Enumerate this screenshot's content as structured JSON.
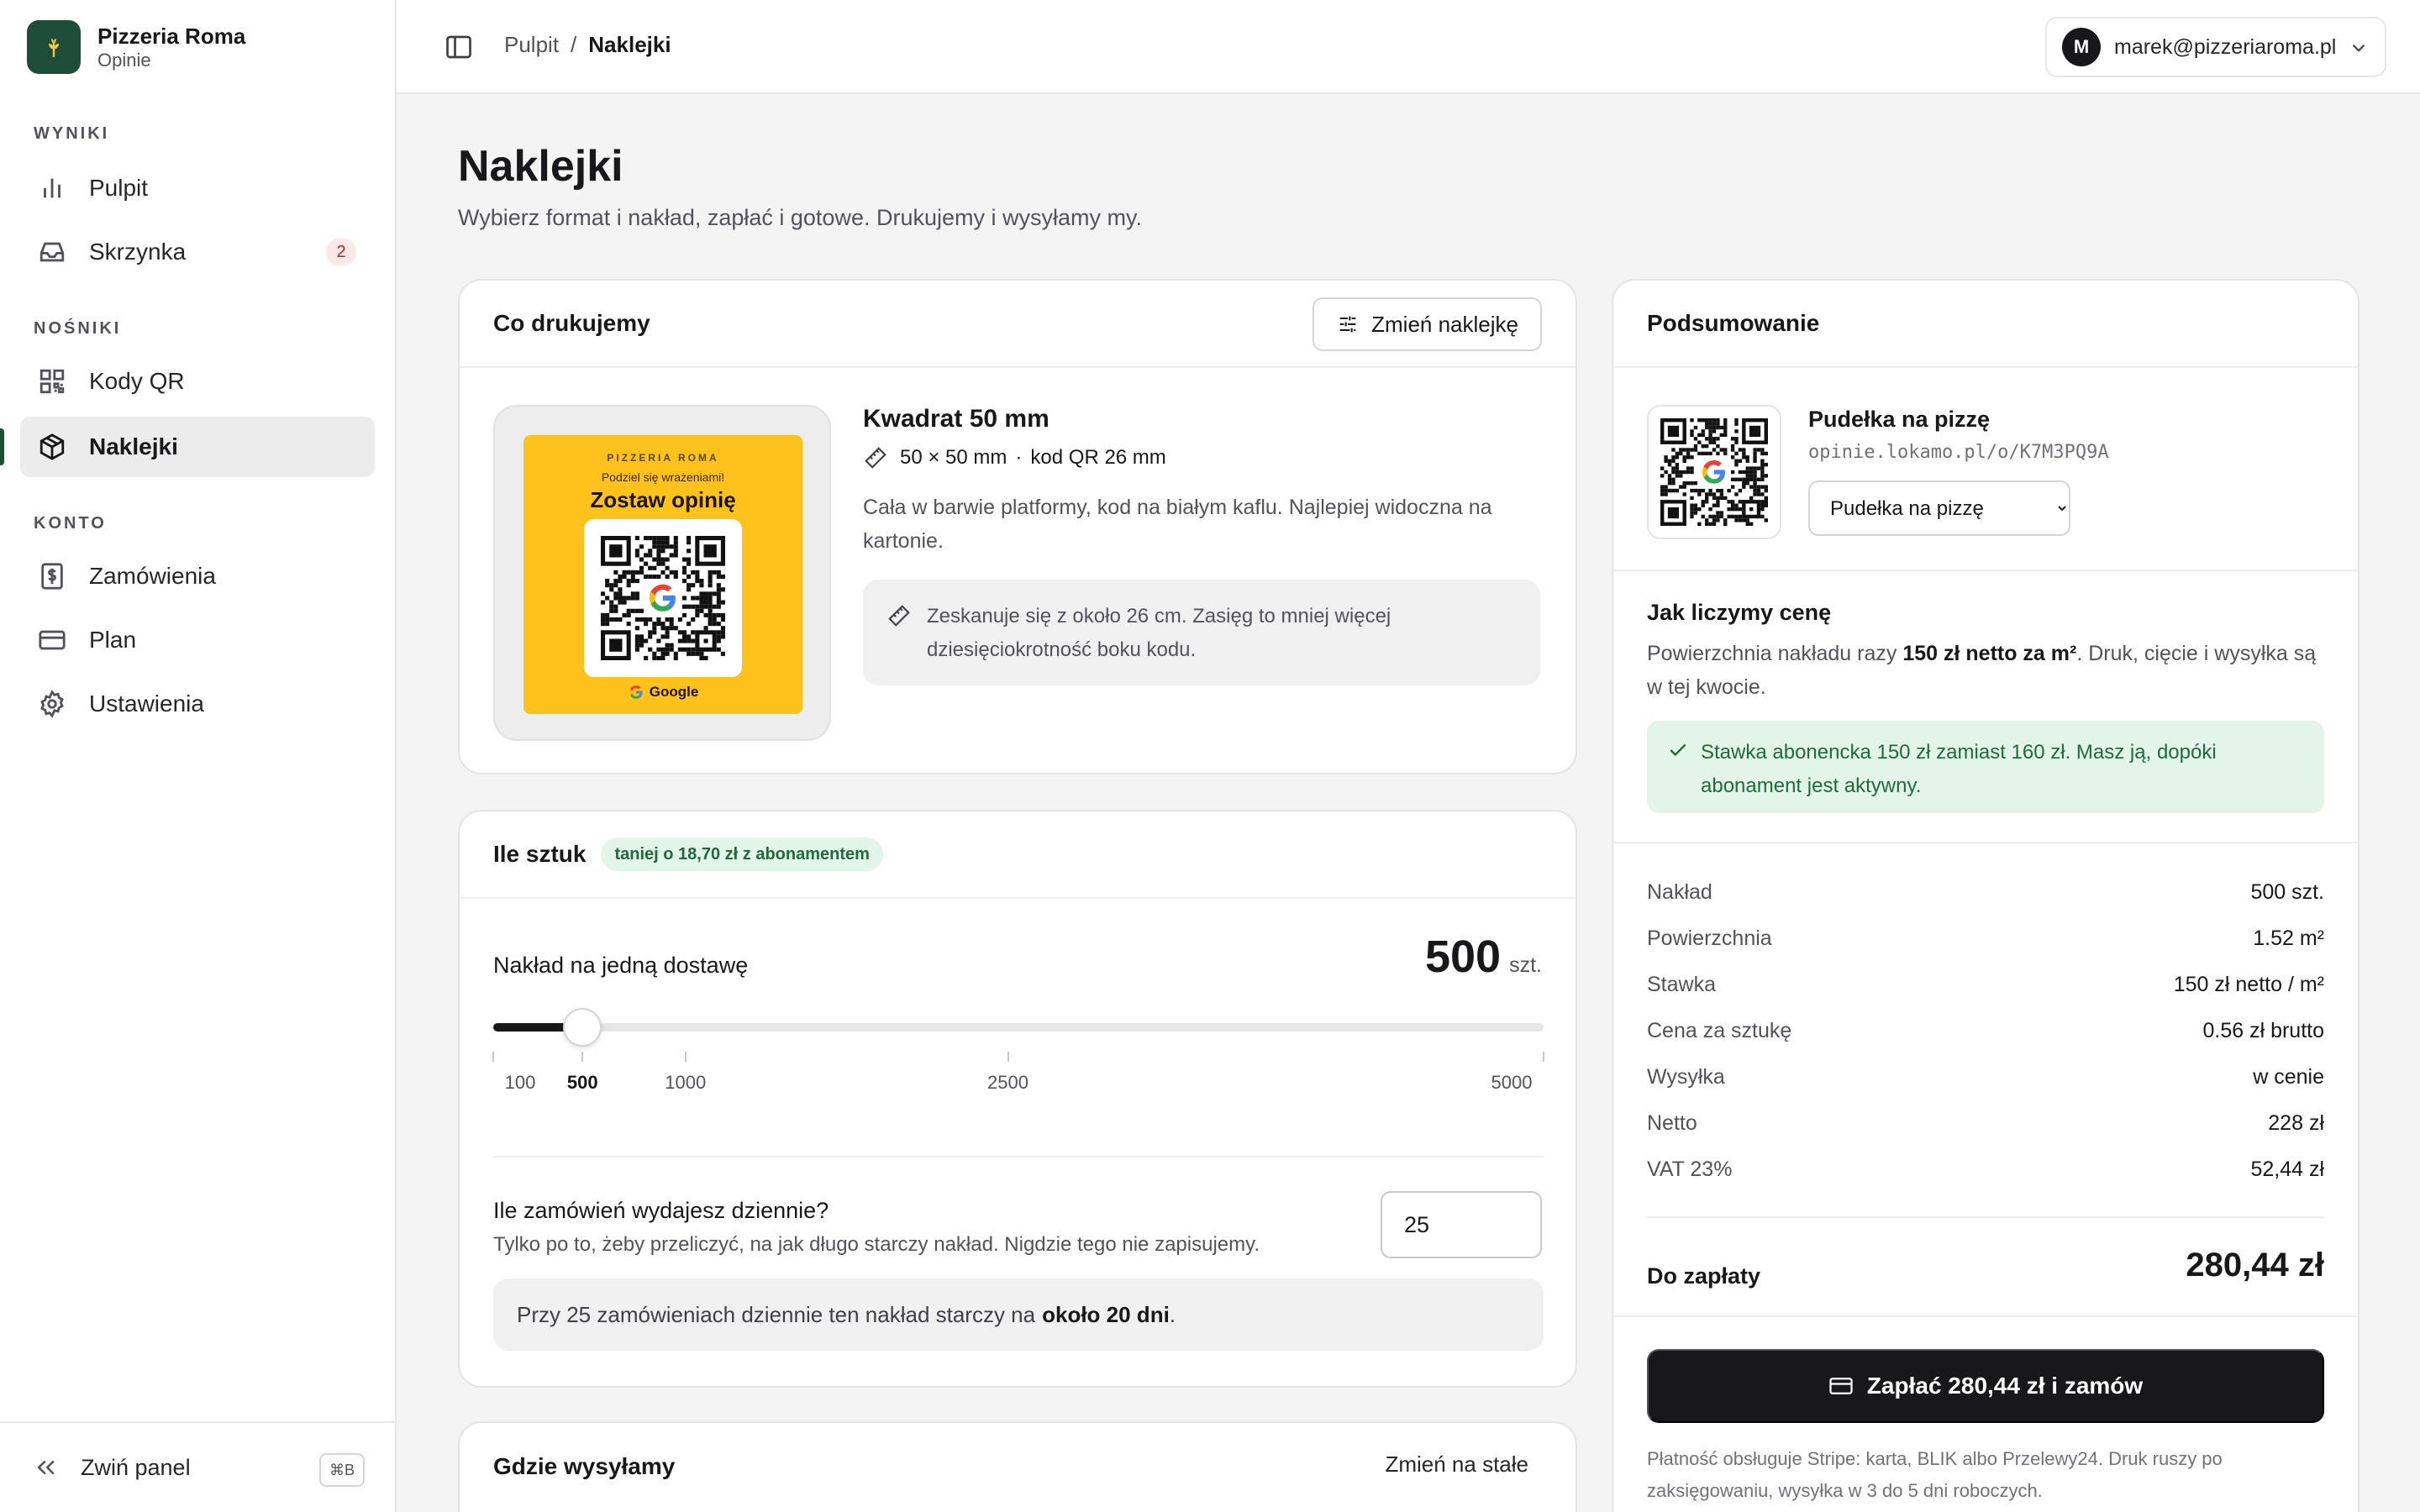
{
  "brand": {
    "name": "Pizzeria Roma",
    "subtitle": "Opinie"
  },
  "sidebar": {
    "sections": [
      {
        "label": "WYNIKI"
      },
      {
        "label": "NOŚNIKI"
      },
      {
        "label": "KONTO"
      }
    ],
    "items": [
      {
        "label": "Pulpit",
        "icon": "bar-chart-icon"
      },
      {
        "label": "Skrzynka",
        "icon": "inbox-icon",
        "badge": "2"
      },
      {
        "label": "Kody QR",
        "icon": "qr-code-icon"
      },
      {
        "label": "Naklejki",
        "icon": "box-icon",
        "active": true
      },
      {
        "label": "Zamówienia",
        "icon": "receipt-icon"
      },
      {
        "label": "Plan",
        "icon": "credit-card-icon"
      },
      {
        "label": "Ustawienia",
        "icon": "gear-icon"
      }
    ],
    "collapse_label": "Zwiń panel",
    "collapse_shortcut": "⌘B"
  },
  "topbar": {
    "breadcrumb": [
      "Pulpit",
      "Naklejki"
    ],
    "breadcrumb_sep": "/",
    "avatar_letter": "M",
    "user_email": "marek@pizzeriaroma.pl"
  },
  "page": {
    "title": "Naklejki",
    "subtitle": "Wybierz format i nakład, zapłać i gotowe. Drukujemy i wysyłamy my."
  },
  "print_card": {
    "title": "Co drukujemy",
    "change_button": "Zmień naklejkę",
    "sticker": {
      "brand": "PIZZERIA ROMA",
      "share": "Podziel się wrażeniami!",
      "headline": "Zostaw opinię",
      "google": "Google",
      "color": "#ffc21a"
    },
    "format_title": "Kwadrat 50 mm",
    "format_size": "50 × 50 mm",
    "format_dot": "·",
    "format_qr": "kod QR 26 mm",
    "description": "Cała w barwie platformy, kod na białym kaflu. Najlepiej widoczna na kartonie.",
    "info": "Zeskanuje się z około 26 cm. Zasięg to mniej więcej dziesięciokrotność boku kodu."
  },
  "qty_card": {
    "title": "Ile sztuk",
    "pill": "taniej o 18,70 zł z abonamentem",
    "label": "Nakład na jedną dostawę",
    "value": "500",
    "unit": "szt.",
    "slider": {
      "min": 100,
      "max": 5000,
      "value": 500
    },
    "ticks": [
      {
        "label": "100",
        "value": 100
      },
      {
        "label": "500",
        "value": 500,
        "selected": true
      },
      {
        "label": "1000",
        "value": 1000
      },
      {
        "label": "2500",
        "value": 2500
      },
      {
        "label": "5000",
        "value": 5000
      }
    ],
    "daily_label": "Ile zamówień wydajesz dziennie?",
    "daily_help": "Tylko po to, żeby przeliczyć, na jak długo starczy nakład. Nigdzie tego nie zapisujemy.",
    "daily_value": "25",
    "calc_text": "Przy 25 zamówieniach dziennie ten nakład starczy na",
    "calc_bold": "około 20 dni",
    "calc_end": "."
  },
  "ship_card": {
    "title": "Gdzie wysyłamy",
    "change_link": "Zmień na stałe"
  },
  "summary": {
    "title": "Podsumowanie",
    "product_name": "Pudełka na pizzę",
    "product_url": "opinie.lokamo.pl/o/K7M3PQ9A",
    "select_value": "Pudełka na pizzę",
    "how_title": "Jak liczymy cenę",
    "how_text_1": "Powierzchnia nakładu razy",
    "how_bold": "150 zł netto za m²",
    "how_text_2": ". Druk, cięcie i wysyłka są w tej kwocie.",
    "green_note": "Stawka abonencka 150 zł zamiast 160 zł. Masz ją, dopóki abonament jest aktywny.",
    "rows": [
      {
        "k": "Nakład",
        "v": "500 szt."
      },
      {
        "k": "Powierzchnia",
        "v": "1.52 m²"
      },
      {
        "k": "Stawka",
        "v": "150 zł netto / m²"
      },
      {
        "k": "Cena za sztukę",
        "v": "0.56 zł brutto"
      },
      {
        "k": "Wysyłka",
        "v": "w cenie"
      },
      {
        "k": "Netto",
        "v": "228 zł"
      },
      {
        "k": "VAT 23%",
        "v": "52,44 zł"
      }
    ],
    "total_label": "Do zapłaty",
    "total_value": "280,44 zł",
    "pay_button": "Zapłać 280,44 zł i zamów",
    "pay_note": "Płatność obsługuje Stripe: karta, BLIK albo Przelewy24. Druk ruszy po zaksięgowaniu, wysyłka w 3 do 5 dni roboczych."
  },
  "colors": {
    "brand": "#1e4d3a",
    "accent_green": "#1e6b3c",
    "dark": "#18181b"
  }
}
